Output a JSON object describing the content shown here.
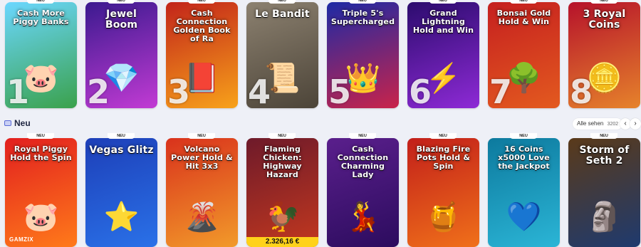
{
  "top_row": [
    {
      "title": "Cash More Piggy Banks",
      "rank": "1",
      "badge": "NEU",
      "colors": [
        "#6bd7ff",
        "#3aa14b"
      ],
      "icon": "pig"
    },
    {
      "title": "Jewel Boom",
      "rank": "2",
      "badge": "NEU",
      "colors": [
        "#3b1a8f",
        "#c23bd4"
      ],
      "icon": "diamond"
    },
    {
      "title": "Cash Connection Golden Book of Ra",
      "rank": "3",
      "badge": "NEU",
      "colors": [
        "#c2241a",
        "#f8a21a"
      ],
      "icon": "book"
    },
    {
      "title": "Le Bandit",
      "rank": "4",
      "badge": "NEU",
      "colors": [
        "#8c8170",
        "#4c4438"
      ],
      "icon": "wanted-poster"
    },
    {
      "title": "Triple 5's Supercharged",
      "rank": "5",
      "badge": "NEU",
      "colors": [
        "#1d2aa5",
        "#c9234a"
      ],
      "icon": "king"
    },
    {
      "title": "Grand Lightning Hold and Win",
      "rank": "6",
      "badge": "NEU",
      "colors": [
        "#2c0c6e",
        "#8e2ad6"
      ],
      "icon": "lightning"
    },
    {
      "title": "Bonsai Gold Hold & Win",
      "rank": "7",
      "badge": "NEU",
      "colors": [
        "#c51f1f",
        "#e35a1f"
      ],
      "icon": "tree"
    },
    {
      "title": "3 Royal Coins",
      "rank": "8",
      "badge": "NEU",
      "colors": [
        "#b6122b",
        "#e6832b"
      ],
      "icon": "coin"
    }
  ],
  "section": {
    "title": "Neu",
    "see_all_label": "Alle sehen",
    "see_all_count": "3202",
    "prev_label": "‹",
    "next_label": "›"
  },
  "bottom_row": [
    {
      "title": "Royal Piggy Hold the Spin",
      "badge": "NEU",
      "colors": [
        "#e21f1f",
        "#ff7a1a"
      ],
      "icon": "pig",
      "provider": "GAMZIX"
    },
    {
      "title": "Vegas Glitz",
      "badge": "NEU",
      "colors": [
        "#1d3fb8",
        "#2a71e8"
      ],
      "icon": "star"
    },
    {
      "title": "Volcano Power Hold & Hit 3x3",
      "badge": "NEU",
      "colors": [
        "#d9321c",
        "#f29a2a"
      ],
      "icon": "volcano"
    },
    {
      "title": "Flaming Chicken: Highway Hazard",
      "badge": "NEU",
      "colors": [
        "#6e1a2a",
        "#c2381f"
      ],
      "icon": "chicken",
      "jackpot": "2.326,16 €"
    },
    {
      "title": "Cash Connection Charming Lady",
      "badge": "NEU",
      "colors": [
        "#5a1f8c",
        "#2c0c5e"
      ],
      "icon": "lady"
    },
    {
      "title": "Blazing Fire Pots Hold & Spin",
      "badge": "NEU",
      "colors": [
        "#c21f1a",
        "#f0701a"
      ],
      "icon": "pot"
    },
    {
      "title": "16 Coins x5000 Love the Jackpot",
      "badge": "NEU",
      "colors": [
        "#0d7a9e",
        "#2bb5d6"
      ],
      "icon": "heart"
    },
    {
      "title": "Storm of Seth 2",
      "badge": "NEU",
      "colors": [
        "#5a3a1a",
        "#1f3a6e"
      ],
      "icon": "pharaoh"
    }
  ]
}
